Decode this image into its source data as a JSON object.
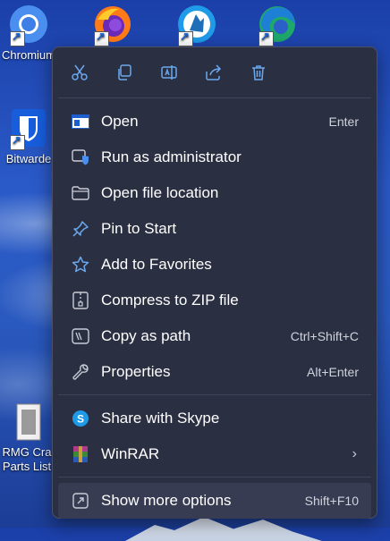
{
  "desktop": {
    "icons": [
      {
        "name": "chromium-icon",
        "label": "Chromium"
      },
      {
        "name": "firefox-icon",
        "label": ""
      },
      {
        "name": "waterfox-icon",
        "label": ""
      },
      {
        "name": "edge-icon",
        "label": ""
      },
      {
        "name": "bitwarden-icon",
        "label": "Bitwarde"
      },
      {
        "name": "document-icon",
        "label_line1": "RMG Cra",
        "label_line2": "Parts List"
      }
    ]
  },
  "menu": {
    "toolbar": [
      "cut-icon",
      "copy-icon",
      "rename-icon",
      "share-icon",
      "delete-icon"
    ],
    "group1": [
      {
        "label": "Open",
        "shortcut": "Enter",
        "icon": "open-window-icon"
      },
      {
        "label": "Run as administrator",
        "shortcut": "",
        "icon": "shield-icon"
      },
      {
        "label": "Open file location",
        "shortcut": "",
        "icon": "folder-icon"
      },
      {
        "label": "Pin to Start",
        "shortcut": "",
        "icon": "pin-icon"
      },
      {
        "label": "Add to Favorites",
        "shortcut": "",
        "icon": "star-icon"
      },
      {
        "label": "Compress to ZIP file",
        "shortcut": "",
        "icon": "zip-icon"
      },
      {
        "label": "Copy as path",
        "shortcut": "Ctrl+Shift+C",
        "icon": "path-icon"
      },
      {
        "label": "Properties",
        "shortcut": "Alt+Enter",
        "icon": "wrench-icon"
      }
    ],
    "group2": [
      {
        "label": "Share with Skype",
        "shortcut": "",
        "icon": "skype-icon"
      },
      {
        "label": "WinRAR",
        "shortcut": "",
        "icon": "winrar-icon",
        "submenu": "›"
      }
    ],
    "group3": [
      {
        "label": "Show more options",
        "shortcut": "Shift+F10",
        "icon": "more-options-icon"
      }
    ]
  },
  "colors": {
    "menu_bg": "#2b2f42",
    "accent": "#6aa8f0",
    "hover_bg": "#383c52"
  }
}
